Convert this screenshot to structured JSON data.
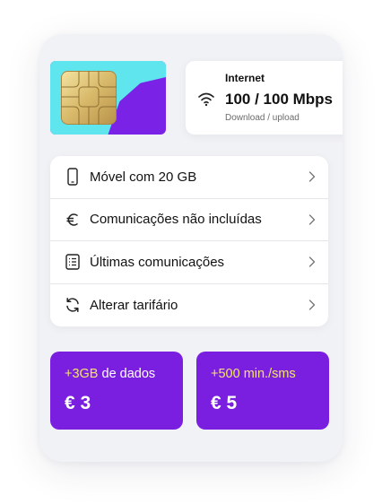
{
  "internet": {
    "title": "Internet",
    "speed": "100 / 100 Mbps",
    "subtitle": "Download / upload",
    "icon": "wifi-icon"
  },
  "menu": {
    "items": [
      {
        "label": "Móvel com 20 GB",
        "icon": "mobile-phone-icon"
      },
      {
        "label": "Comunicações não incluídas",
        "icon": "euro-icon"
      },
      {
        "label": "Últimas comunicações",
        "icon": "list-icon"
      },
      {
        "label": "Alterar tarifário",
        "icon": "refresh-icon"
      }
    ]
  },
  "offers": [
    {
      "highlight": "+3GB",
      "rest": " de dados",
      "price": "€ 3"
    },
    {
      "highlight": "+500 min./sms",
      "rest": "",
      "price": "€ 5"
    }
  ],
  "colors": {
    "accent_purple": "#7a1fe0",
    "sim_cyan": "#5ee5ee",
    "offer_highlight": "#f2e66a"
  }
}
